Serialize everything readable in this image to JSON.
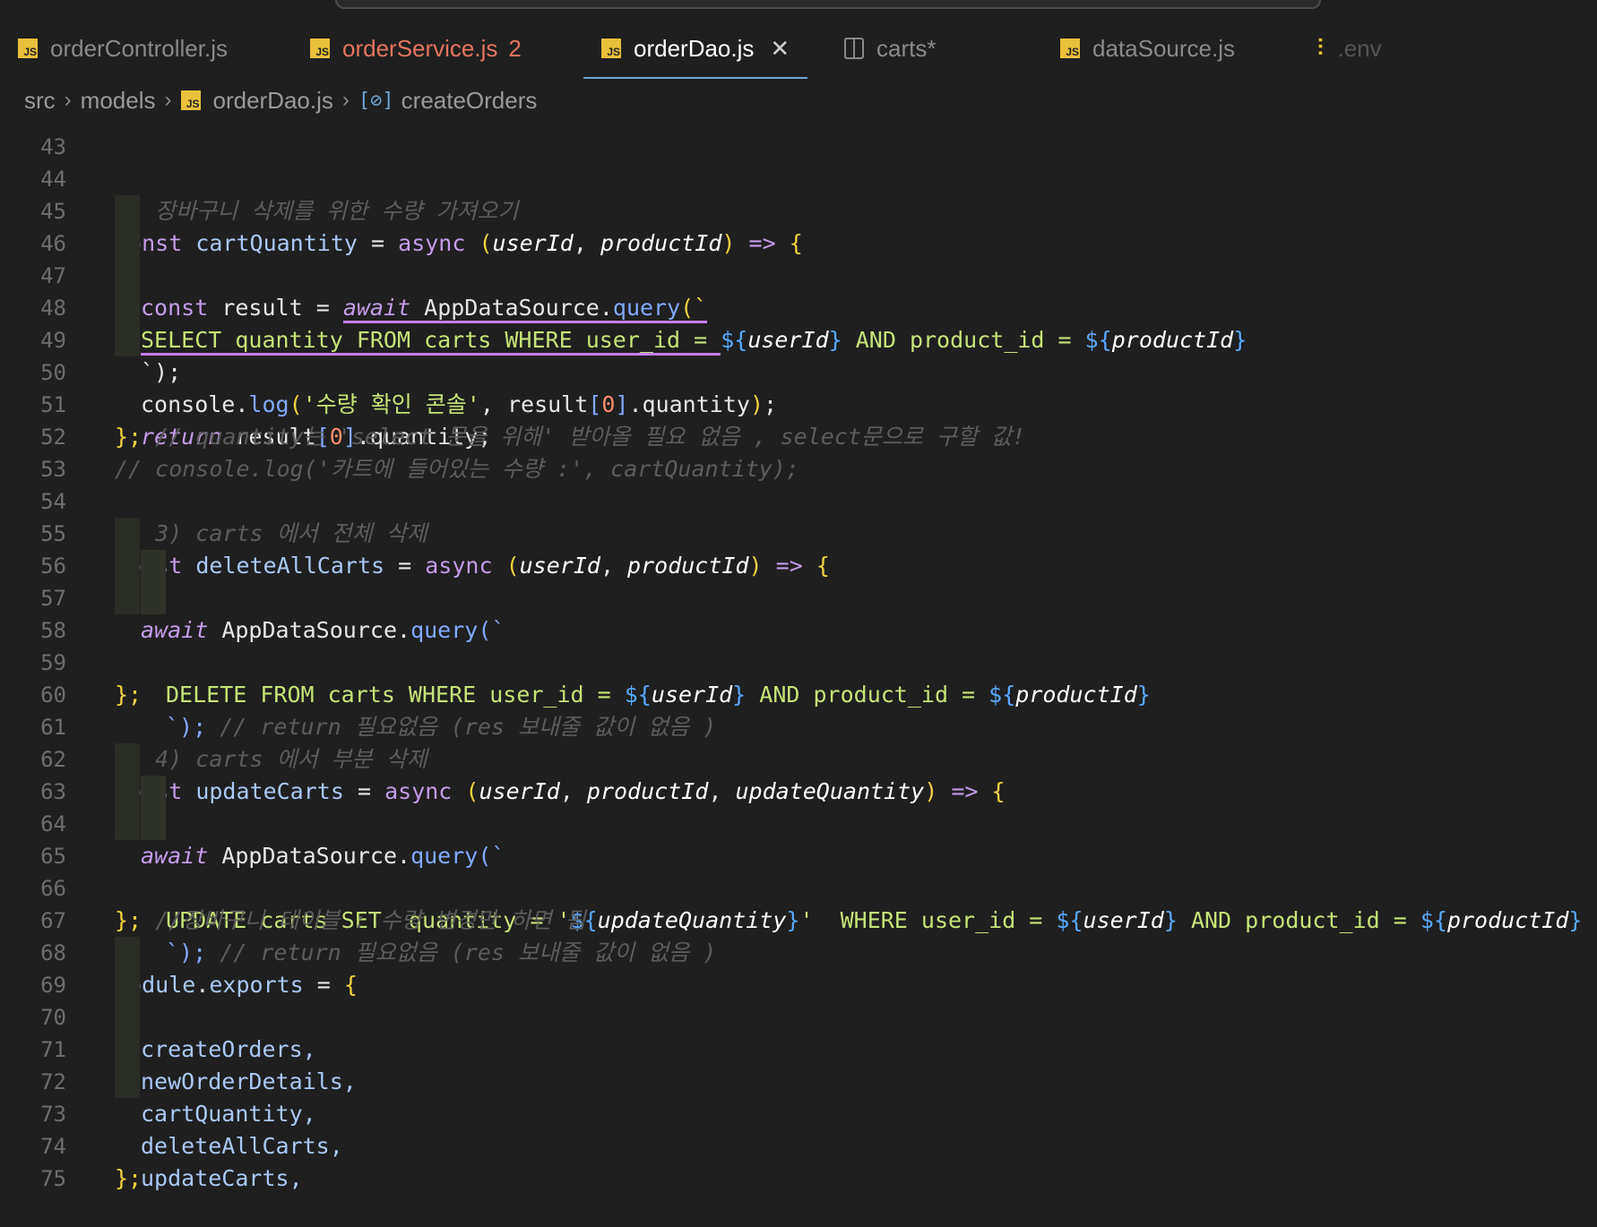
{
  "tabs": [
    {
      "label": "orderController.js",
      "icon": "js-file-icon",
      "state": "normal"
    },
    {
      "label": "orderService.js",
      "icon": "js-file-icon",
      "state": "modified",
      "badge": "2"
    },
    {
      "label": "orderDao.js",
      "icon": "js-file-icon",
      "state": "active",
      "close": "✕"
    },
    {
      "label": "carts*",
      "icon": "split-icon",
      "state": "normal"
    },
    {
      "label": "dataSource.js",
      "icon": "js-file-icon",
      "state": "normal"
    },
    {
      "label": ".env",
      "icon": "settings-icon",
      "state": "dim"
    }
  ],
  "breadcrumb": {
    "items": [
      "src",
      "models",
      "orderDao.js",
      "createOrders"
    ],
    "separator": "›"
  },
  "line_numbers": [
    "43",
    "44",
    "45",
    "46",
    "47",
    "48",
    "49",
    "50",
    "51",
    "52",
    "53",
    "54",
    "55",
    "56",
    "57",
    "58",
    "59",
    "60",
    "61",
    "62",
    "63",
    "64",
    "65",
    "66",
    "67",
    "68",
    "69",
    "70",
    "71",
    "72",
    "73",
    "74",
    "75"
  ],
  "code": {
    "l44": "// 장바구니 삭제를 위한 수량 가져오기",
    "l45": {
      "kw": "const",
      "name": "cartQuantity",
      "eq": "=",
      "async": "async",
      "p1": "userId",
      "p2": "productId",
      "arrow": "=>",
      "brace": "{"
    },
    "l46": {
      "kw": "const",
      "name": "result",
      "eq": "=",
      "await": "await",
      "obj": "AppDataSource",
      "method": "query",
      "tick": "(`"
    },
    "l47": {
      "a": "SELECT quantity FROM carts WHERE user_id = ",
      "i1": "userId",
      "b": " AND product_id = ",
      "i2": "productId"
    },
    "l48": "`);",
    "l49": {
      "obj": "console",
      "method": "log",
      "str": "'수량 확인 콘솔'",
      "rest": "result",
      "idx": "0",
      "prop": "quantity"
    },
    "l50": {
      "kw": "return",
      "obj": "result",
      "idx": "0",
      "prop": "quantity"
    },
    "l51": {
      "close": "};",
      "cmt": "// quantity는 'select 문을 위해' 받아올 필요 없음 , select문으로 구할 값!"
    },
    "l52": "// console.log('카트에 들어있는 수량 :', cartQuantity);",
    "l54": "// 3) carts 에서 전체 삭제",
    "l55": {
      "kw": "const",
      "name": "deleteAllCarts",
      "eq": "=",
      "async": "async",
      "p1": "userId",
      "p2": "productId",
      "arrow": "=>",
      "brace": "{"
    },
    "l56": {
      "await": "await",
      "obj": "AppDataSource",
      "method": "query",
      "tick": "(`"
    },
    "l57": {
      "a": "DELETE FROM carts WHERE user_id = ",
      "i1": "userId",
      "b": " AND product_id = ",
      "i2": "productId"
    },
    "l58": {
      "tick": "`);",
      "cmt": "// return 필요없음 (res 보내줄 값이 없음 )"
    },
    "l59": "};",
    "l61": "// 4) carts 에서 부분 삭제",
    "l62": {
      "kw": "const",
      "name": "updateCarts",
      "eq": "=",
      "async": "async",
      "p1": "userId",
      "p2": "productId",
      "p3": "updateQuantity",
      "arrow": "=>",
      "brace": "{"
    },
    "l63": {
      "await": "await",
      "obj": "AppDataSource",
      "method": "query",
      "tick": "(`"
    },
    "l64": {
      "a": "UPDATE carts SET  quantity = '",
      "i0": "updateQuantity",
      "a2": "'  WHERE user_id = ",
      "i1": "userId",
      "b": " AND product_id = ",
      "i2": "productId"
    },
    "l65": {
      "tick": "`);",
      "cmt": "// return 필요없음 (res 보내줄 값이 없음 )"
    },
    "l66": {
      "close": "};",
      "cmt": "//장바구니 테이블 : 수량 변경만 하면 됨"
    },
    "l68": {
      "obj": "module",
      "prop": "exports",
      "eq": "=",
      "brace": "{"
    },
    "exports": [
      "createOrders,",
      "newOrderDetails,",
      "cartQuantity,",
      "deleteAllCarts,",
      "updateCarts,"
    ],
    "l74": "};"
  },
  "colors": {
    "background": "#1f1f1f",
    "keyword": "#c49be8",
    "function": "#a9c8f5",
    "string": "#c5e478",
    "interpolation": "#5aa8ff",
    "comment": "#5c5c5c",
    "bracket": "#f2d33f",
    "active_tab_underline": "#6fa6d8",
    "modified_tab": "#e57560"
  }
}
